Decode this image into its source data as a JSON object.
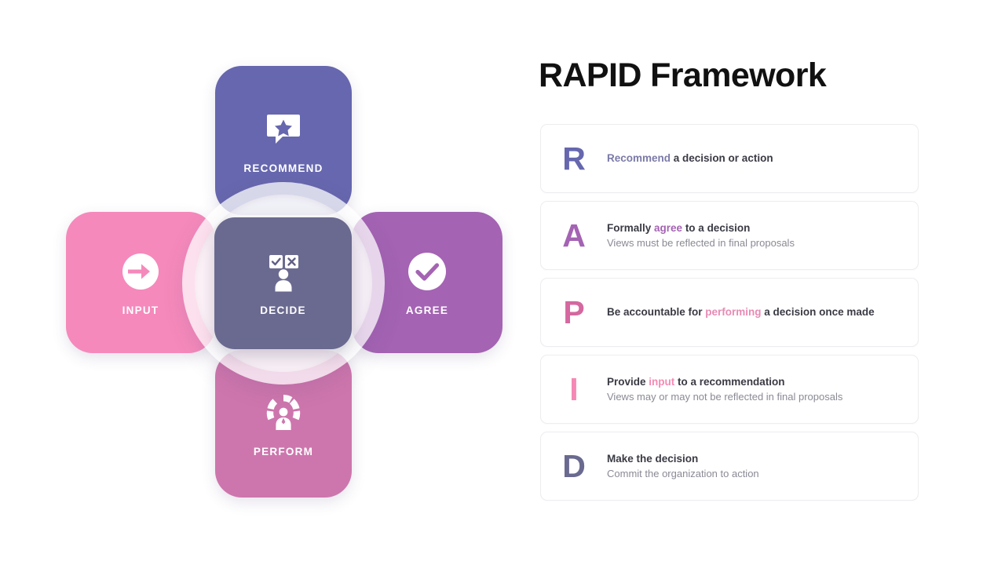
{
  "header": {
    "title": "RAPID Framework"
  },
  "colors": {
    "recommend": "#6667ae",
    "input": "#f589bb",
    "agree": "#a463b3",
    "perform": "#cd76ad",
    "decide": "#6a6a90",
    "title_text": "#111111",
    "body_text": "#3a3a44",
    "sub_text": "#8a8a95",
    "card_border": "#ededf1",
    "background": "#ffffff"
  },
  "diagram": {
    "petals": [
      {
        "id": "recommend",
        "label": "RECOMMEND",
        "icon": "speech-bubble-star-icon",
        "color": "#6667ae"
      },
      {
        "id": "input",
        "label": "INPUT",
        "icon": "arrow-into-circle-icon",
        "color": "#f589bb"
      },
      {
        "id": "agree",
        "label": "AGREE",
        "icon": "check-circle-icon",
        "color": "#a463b3"
      },
      {
        "id": "perform",
        "label": "PERFORM",
        "icon": "person-in-gear-ring-icon",
        "color": "#cd76ad"
      }
    ],
    "center": {
      "id": "decide",
      "label": "DECIDE",
      "icon": "person-with-approve-reject-icon",
      "color": "#6a6a90"
    }
  },
  "list": {
    "items": [
      {
        "letter": "R",
        "letter_color": "#6667ae",
        "title_before": "",
        "title_highlight": "Recommend",
        "title_after": " a decision or action",
        "highlight_color": "#7a7aa8",
        "subtitle": ""
      },
      {
        "letter": "A",
        "letter_color": "#a463b3",
        "title_before": "Formally ",
        "title_highlight": "agree",
        "title_after": " to a decision",
        "highlight_color": "#a463b3",
        "subtitle": "Views must be reflected in final proposals"
      },
      {
        "letter": "P",
        "letter_color": "#d4689f",
        "title_before": "Be accountable for ",
        "title_highlight": "performing",
        "title_after": " a decision once made",
        "highlight_color": "#e78ab4",
        "subtitle": ""
      },
      {
        "letter": "I",
        "letter_color": "#f589b4",
        "title_before": "Provide ",
        "title_highlight": "input",
        "title_after": " to a recommendation",
        "highlight_color": "#f589b4",
        "subtitle": "Views may or may not be reflected in final proposals"
      },
      {
        "letter": "D",
        "letter_color": "#6a6a90",
        "title_before": "Make the decision",
        "title_highlight": "",
        "title_after": "",
        "highlight_color": "#6a6a90",
        "subtitle": "Commit the organization to action"
      }
    ]
  }
}
